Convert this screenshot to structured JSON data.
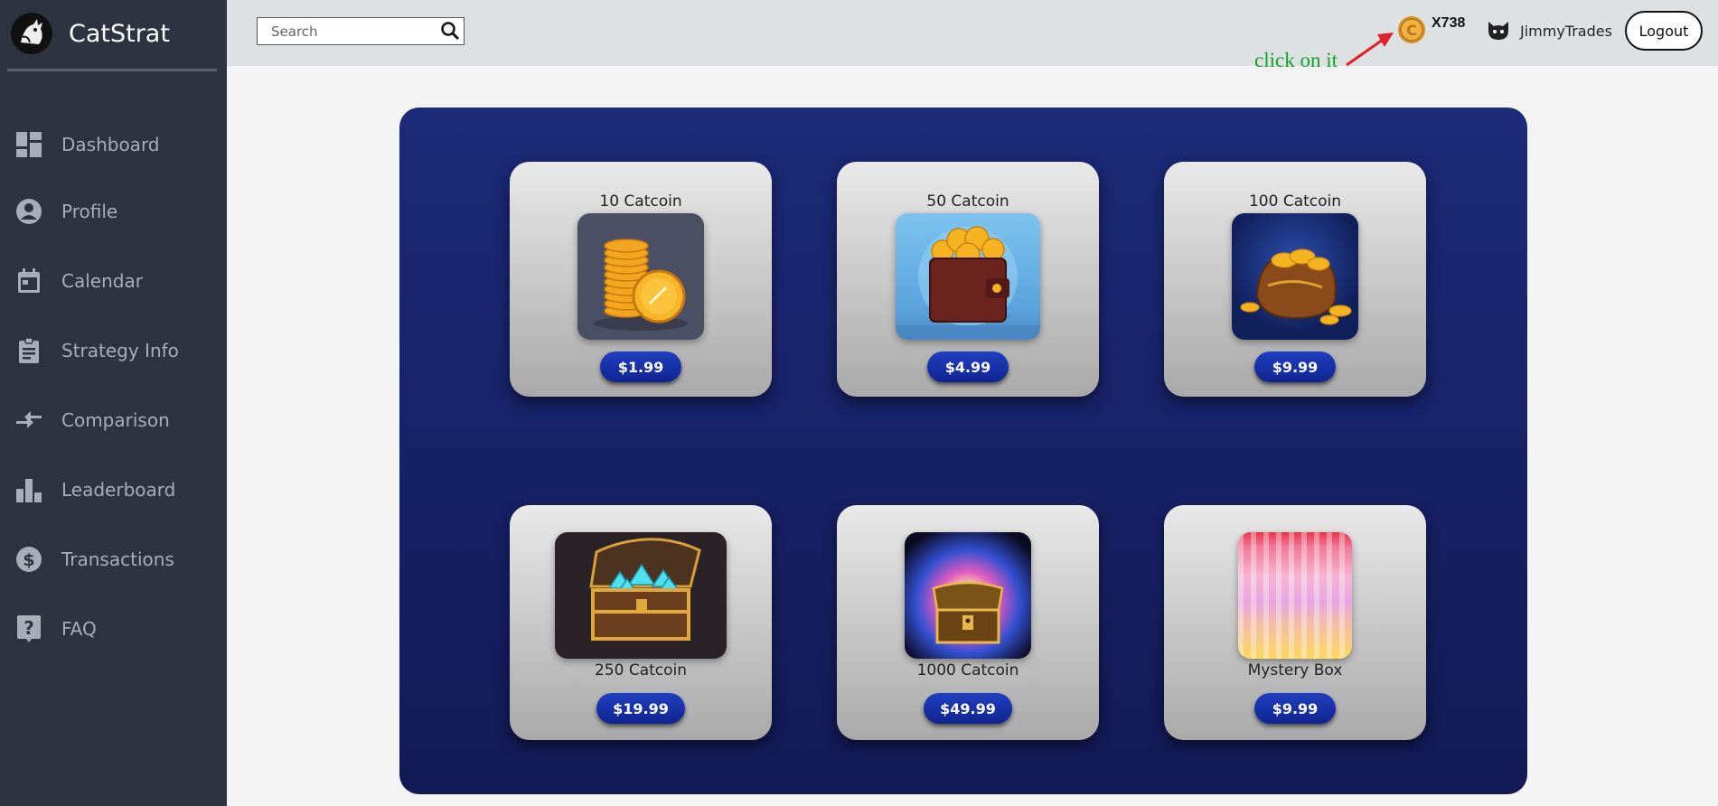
{
  "app": {
    "name": "CatStrat"
  },
  "sidebar": {
    "items": [
      {
        "label": "Dashboard",
        "icon": "dashboard-icon"
      },
      {
        "label": "Profile",
        "icon": "profile-icon"
      },
      {
        "label": "Calendar",
        "icon": "calendar-icon"
      },
      {
        "label": "Strategy Info",
        "icon": "clipboard-icon"
      },
      {
        "label": "Comparison",
        "icon": "compare-arrows-icon"
      },
      {
        "label": "Leaderboard",
        "icon": "bar-chart-icon"
      },
      {
        "label": "Transactions",
        "icon": "dollar-icon"
      },
      {
        "label": "FAQ",
        "icon": "help-icon"
      }
    ]
  },
  "header": {
    "search_placeholder": "Search",
    "coin_count": "X738",
    "annotation": "click on it",
    "username": "JimmyTrades",
    "logout_label": "Logout"
  },
  "colors": {
    "sidebar_bg": "#2d3340",
    "panel_bg": "#1c2a78",
    "button_bg": "#1f3fc0",
    "annotation": "#15a02a"
  },
  "store": {
    "items": [
      {
        "title": "10 Catcoin",
        "price": "$1.99",
        "image": "coin-stack-image"
      },
      {
        "title": "50 Catcoin",
        "price": "$4.99",
        "image": "wallet-image"
      },
      {
        "title": "100 Catcoin",
        "price": "$9.99",
        "image": "coin-bag-image"
      },
      {
        "title": "250 Catcoin",
        "price": "$19.99",
        "image": "gem-chest-image"
      },
      {
        "title": "1000 Catcoin",
        "price": "$49.99",
        "image": "treasure-chest-image"
      },
      {
        "title": "Mystery Box",
        "price": "$9.99",
        "image": "mystery-box-image"
      }
    ]
  }
}
